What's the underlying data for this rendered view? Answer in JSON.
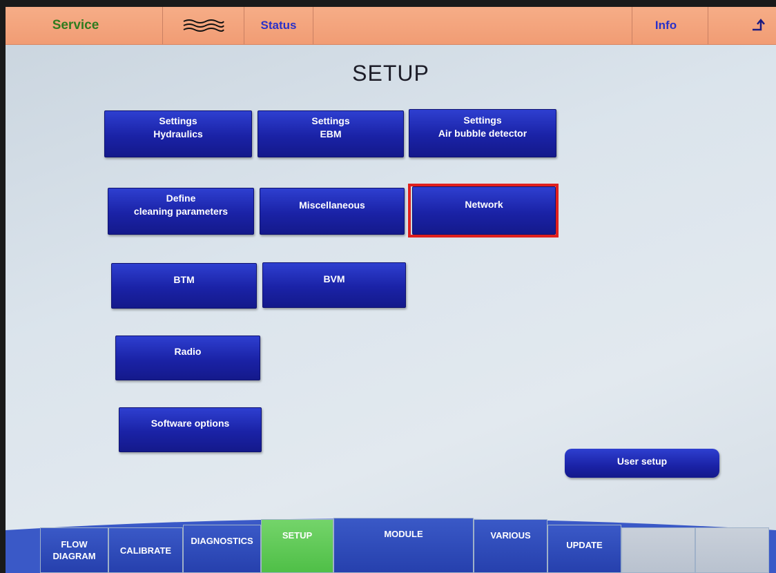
{
  "topbar": {
    "service_label": "Service",
    "wave_icon": "wave-icon",
    "status_label": "Status",
    "info_label": "Info",
    "exit_icon": "exit-arrow-icon"
  },
  "title": "SETUP",
  "buttons": {
    "hydraulics": [
      "Settings",
      "Hydraulics"
    ],
    "ebm": [
      "Settings",
      "EBM"
    ],
    "air_bubble": [
      "Settings",
      "Air bubble detector"
    ],
    "cleaning": [
      "Define",
      "cleaning parameters"
    ],
    "miscellaneous": "Miscellaneous",
    "network": "Network",
    "btm": "BTM",
    "bvm": "BVM",
    "radio": "Radio",
    "software_options": "Software options",
    "user_setup": "User setup"
  },
  "highlight": {
    "target": "Network",
    "color": "#e0201e"
  },
  "nav": {
    "flow_diagram": [
      "FLOW",
      "DIAGRAM"
    ],
    "calibrate": "CALIBRATE",
    "diagnostics": "DIAGNOSTICS",
    "setup": "SETUP",
    "module": "MODULE",
    "various": "VARIOUS",
    "update": "UPDATE",
    "active": "SETUP"
  },
  "colors": {
    "topbar": "#f19c74",
    "button": "#1a22a6",
    "active_tab": "#4fbf47",
    "service_text": "#2f7c1f",
    "link_text": "#2a31c9"
  }
}
